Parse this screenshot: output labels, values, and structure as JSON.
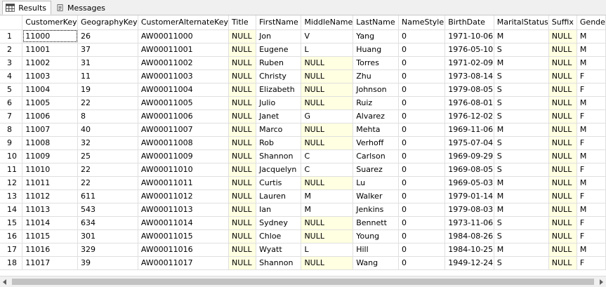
{
  "tabs": [
    {
      "label": "Results",
      "icon": "grid-icon",
      "active": true
    },
    {
      "label": "Messages",
      "icon": "messages-icon",
      "active": false
    }
  ],
  "grid": {
    "columns": [
      "CustomerKey",
      "GeographyKey",
      "CustomerAlternateKey",
      "Title",
      "FirstName",
      "MiddleName",
      "LastName",
      "NameStyle",
      "BirthDate",
      "MaritalStatus",
      "Suffix",
      "Gende"
    ],
    "rows": [
      [
        "1",
        "11000",
        "26",
        "AW00011000",
        "NULL",
        "Jon",
        "V",
        "Yang",
        "0",
        "1971-10-06",
        "M",
        "NULL",
        "M"
      ],
      [
        "2",
        "11001",
        "37",
        "AW00011001",
        "NULL",
        "Eugene",
        "L",
        "Huang",
        "0",
        "1976-05-10",
        "S",
        "NULL",
        "M"
      ],
      [
        "3",
        "11002",
        "31",
        "AW00011002",
        "NULL",
        "Ruben",
        "NULL",
        "Torres",
        "0",
        "1971-02-09",
        "M",
        "NULL",
        "M"
      ],
      [
        "4",
        "11003",
        "11",
        "AW00011003",
        "NULL",
        "Christy",
        "NULL",
        "Zhu",
        "0",
        "1973-08-14",
        "S",
        "NULL",
        "F"
      ],
      [
        "5",
        "11004",
        "19",
        "AW00011004",
        "NULL",
        "Elizabeth",
        "NULL",
        "Johnson",
        "0",
        "1979-08-05",
        "S",
        "NULL",
        "F"
      ],
      [
        "6",
        "11005",
        "22",
        "AW00011005",
        "NULL",
        "Julio",
        "NULL",
        "Ruiz",
        "0",
        "1976-08-01",
        "S",
        "NULL",
        "M"
      ],
      [
        "7",
        "11006",
        "8",
        "AW00011006",
        "NULL",
        "Janet",
        "G",
        "Alvarez",
        "0",
        "1976-12-02",
        "S",
        "NULL",
        "F"
      ],
      [
        "8",
        "11007",
        "40",
        "AW00011007",
        "NULL",
        "Marco",
        "NULL",
        "Mehta",
        "0",
        "1969-11-06",
        "M",
        "NULL",
        "M"
      ],
      [
        "9",
        "11008",
        "32",
        "AW00011008",
        "NULL",
        "Rob",
        "NULL",
        "Verhoff",
        "0",
        "1975-07-04",
        "S",
        "NULL",
        "F"
      ],
      [
        "10",
        "11009",
        "25",
        "AW00011009",
        "NULL",
        "Shannon",
        "C",
        "Carlson",
        "0",
        "1969-09-29",
        "S",
        "NULL",
        "M"
      ],
      [
        "11",
        "11010",
        "22",
        "AW00011010",
        "NULL",
        "Jacquelyn",
        "C",
        "Suarez",
        "0",
        "1969-08-05",
        "S",
        "NULL",
        "F"
      ],
      [
        "12",
        "11011",
        "22",
        "AW00011011",
        "NULL",
        "Curtis",
        "NULL",
        "Lu",
        "0",
        "1969-05-03",
        "M",
        "NULL",
        "M"
      ],
      [
        "13",
        "11012",
        "611",
        "AW00011012",
        "NULL",
        "Lauren",
        "M",
        "Walker",
        "0",
        "1979-01-14",
        "M",
        "NULL",
        "F"
      ],
      [
        "14",
        "11013",
        "543",
        "AW00011013",
        "NULL",
        "Ian",
        "M",
        "Jenkins",
        "0",
        "1979-08-03",
        "M",
        "NULL",
        "M"
      ],
      [
        "15",
        "11014",
        "634",
        "AW00011014",
        "NULL",
        "Sydney",
        "NULL",
        "Bennett",
        "0",
        "1973-11-06",
        "S",
        "NULL",
        "F"
      ],
      [
        "16",
        "11015",
        "301",
        "AW00011015",
        "NULL",
        "Chloe",
        "NULL",
        "Young",
        "0",
        "1984-08-26",
        "S",
        "NULL",
        "F"
      ],
      [
        "17",
        "11016",
        "329",
        "AW00011016",
        "NULL",
        "Wyatt",
        "L",
        "Hill",
        "0",
        "1984-10-25",
        "M",
        "NULL",
        "M"
      ],
      [
        "18",
        "11017",
        "39",
        "AW00011017",
        "NULL",
        "Shannon",
        "NULL",
        "Wang",
        "0",
        "1949-12-24",
        "S",
        "NULL",
        "F"
      ]
    ],
    "null_text": "NULL",
    "null_color": "#ffffe1"
  }
}
